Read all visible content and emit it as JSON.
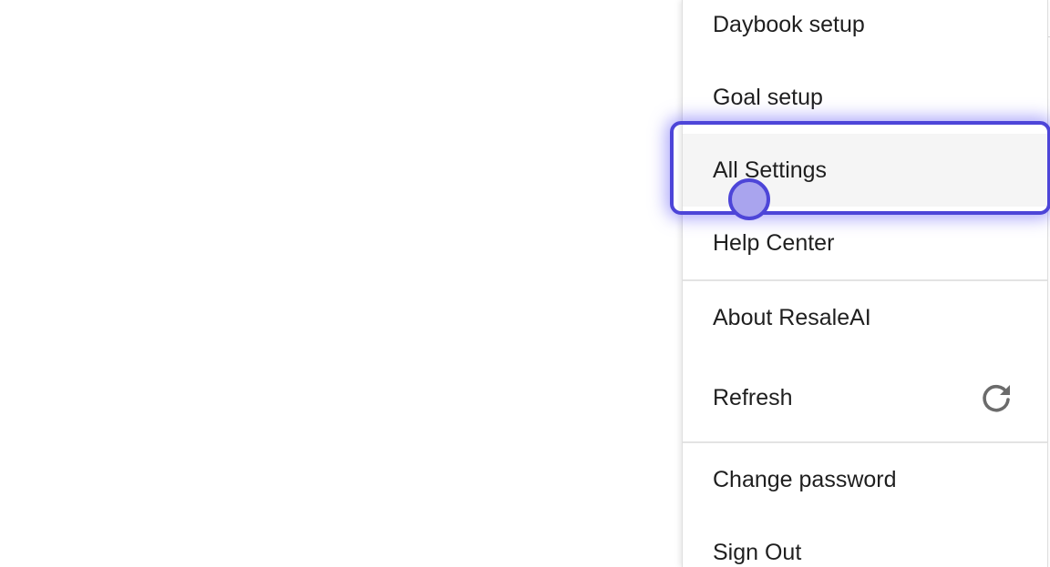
{
  "menu": {
    "items": [
      {
        "label": "Daybook setup"
      },
      {
        "label": "Goal setup"
      },
      {
        "label": "All Settings"
      },
      {
        "label": "Help Center"
      },
      {
        "label": "About ResaleAI"
      },
      {
        "label": "Refresh",
        "icon": "refresh-icon"
      },
      {
        "label": "Change password"
      },
      {
        "label": "Sign Out"
      }
    ],
    "hovered_item": "All Settings"
  },
  "colors": {
    "highlight": "#4d45d8",
    "cursor_fill": "#a9a4ee",
    "hover_bg": "#f5f5f5",
    "text": "#1f1f1f",
    "icon": "#6b6b6b"
  }
}
